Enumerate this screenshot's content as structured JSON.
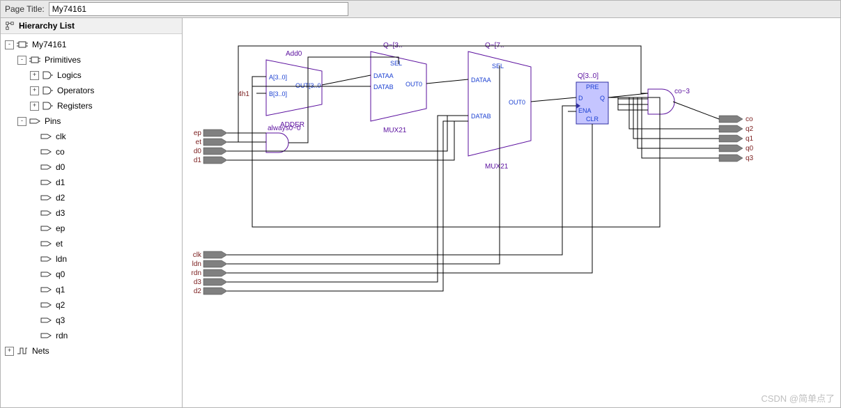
{
  "header": {
    "page_title_label": "Page Title:",
    "page_title_value": "My74161"
  },
  "sidebar": {
    "panel_title": "Hierarchy List",
    "tree": [
      {
        "id": "root",
        "depth": 0,
        "expand": "-",
        "icon": "chip",
        "label": "My74161"
      },
      {
        "id": "prim",
        "depth": 1,
        "expand": "-",
        "icon": "chip",
        "label": "Primitives"
      },
      {
        "id": "logics",
        "depth": 2,
        "expand": "+",
        "icon": "gate",
        "label": "Logics"
      },
      {
        "id": "ops",
        "depth": 2,
        "expand": "+",
        "icon": "gate",
        "label": "Operators"
      },
      {
        "id": "regs",
        "depth": 2,
        "expand": "+",
        "icon": "gate",
        "label": "Registers"
      },
      {
        "id": "pins",
        "depth": 1,
        "expand": "-",
        "icon": "pin",
        "label": "Pins"
      },
      {
        "id": "clk",
        "depth": 2,
        "expand": "",
        "icon": "pin",
        "label": "clk"
      },
      {
        "id": "co",
        "depth": 2,
        "expand": "",
        "icon": "pin",
        "label": "co"
      },
      {
        "id": "d0",
        "depth": 2,
        "expand": "",
        "icon": "pin",
        "label": "d0"
      },
      {
        "id": "d1",
        "depth": 2,
        "expand": "",
        "icon": "pin",
        "label": "d1"
      },
      {
        "id": "d2",
        "depth": 2,
        "expand": "",
        "icon": "pin",
        "label": "d2"
      },
      {
        "id": "d3",
        "depth": 2,
        "expand": "",
        "icon": "pin",
        "label": "d3"
      },
      {
        "id": "ep",
        "depth": 2,
        "expand": "",
        "icon": "pin",
        "label": "ep"
      },
      {
        "id": "et",
        "depth": 2,
        "expand": "",
        "icon": "pin",
        "label": "et"
      },
      {
        "id": "ldn",
        "depth": 2,
        "expand": "",
        "icon": "pin",
        "label": "ldn"
      },
      {
        "id": "q0",
        "depth": 2,
        "expand": "",
        "icon": "pin",
        "label": "q0"
      },
      {
        "id": "q1",
        "depth": 2,
        "expand": "",
        "icon": "pin",
        "label": "q1"
      },
      {
        "id": "q2",
        "depth": 2,
        "expand": "",
        "icon": "pin",
        "label": "q2"
      },
      {
        "id": "q3",
        "depth": 2,
        "expand": "",
        "icon": "pin",
        "label": "q3"
      },
      {
        "id": "rdn",
        "depth": 2,
        "expand": "",
        "icon": "pin",
        "label": "rdn"
      },
      {
        "id": "nets",
        "depth": 0,
        "expand": "+",
        "icon": "net",
        "label": "Nets"
      }
    ]
  },
  "schematic": {
    "input_pins_top": [
      "ep",
      "et",
      "d0",
      "d1"
    ],
    "input_pins_bot": [
      "clk",
      "ldn",
      "rdn",
      "d3",
      "d2"
    ],
    "output_pins": [
      "co",
      "q2",
      "q1",
      "q0",
      "q3"
    ],
    "blocks": {
      "adder": {
        "title": "Add0",
        "type": "ADDER",
        "ports": {
          "a": "A[3..0]",
          "b": "B[3..0]",
          "out": "OUT[3..0"
        }
      },
      "mux1": {
        "title": "Q~[3..",
        "type": "MUX21",
        "ports": {
          "sel": "SEL",
          "da": "DATAA",
          "db": "DATAB",
          "out": "OUT0"
        }
      },
      "mux2": {
        "title": "Q~[7..",
        "type": "MUX21",
        "ports": {
          "sel": "SEL",
          "da": "DATAA",
          "db": "DATAB",
          "out": "OUT0"
        }
      },
      "reg": {
        "title": "Q[3..0]",
        "ports": {
          "pre": "PRE",
          "d": "D",
          "q": "Q",
          "ena": "ENA",
          "clr": "CLR"
        }
      },
      "and_always": {
        "label": "always0~0"
      },
      "and_co": {
        "label": "co~3"
      },
      "const": {
        "label": "4h1"
      }
    }
  },
  "watermark": "CSDN @简单点了"
}
